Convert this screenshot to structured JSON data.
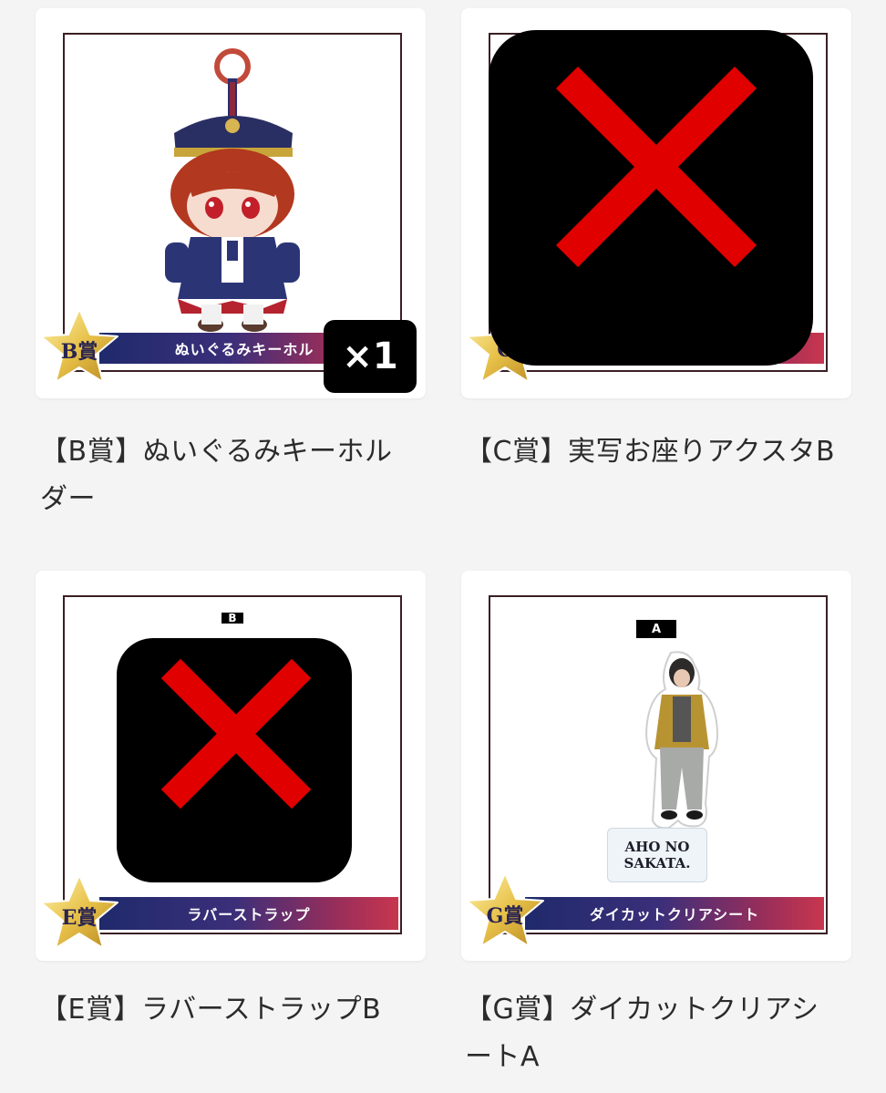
{
  "items": [
    {
      "banner": "ぬいぐるみキーホル",
      "rank": "B賞",
      "count": "×1",
      "caption": "【B賞】ぬいぐるみキーホルダー"
    },
    {
      "banner": "",
      "rank": "C",
      "caption": "【C賞】実写お座りアクスタB"
    },
    {
      "banner": "ラバーストラップ",
      "rank": "E賞",
      "tag": "B",
      "caption": "【E賞】ラバーストラップB"
    },
    {
      "banner": "ダイカットクリアシート",
      "rank": "G賞",
      "tag": "A",
      "plate_text": "AHO NO SAKATA.",
      "caption": "【G賞】ダイカットクリアシートA"
    }
  ],
  "colors": {
    "page_bg": "#f4f4f4",
    "banner_start": "#1f2a6b",
    "banner_end": "#c8364e",
    "star_gold": "#e8c24a",
    "cross_red": "#e00000"
  }
}
